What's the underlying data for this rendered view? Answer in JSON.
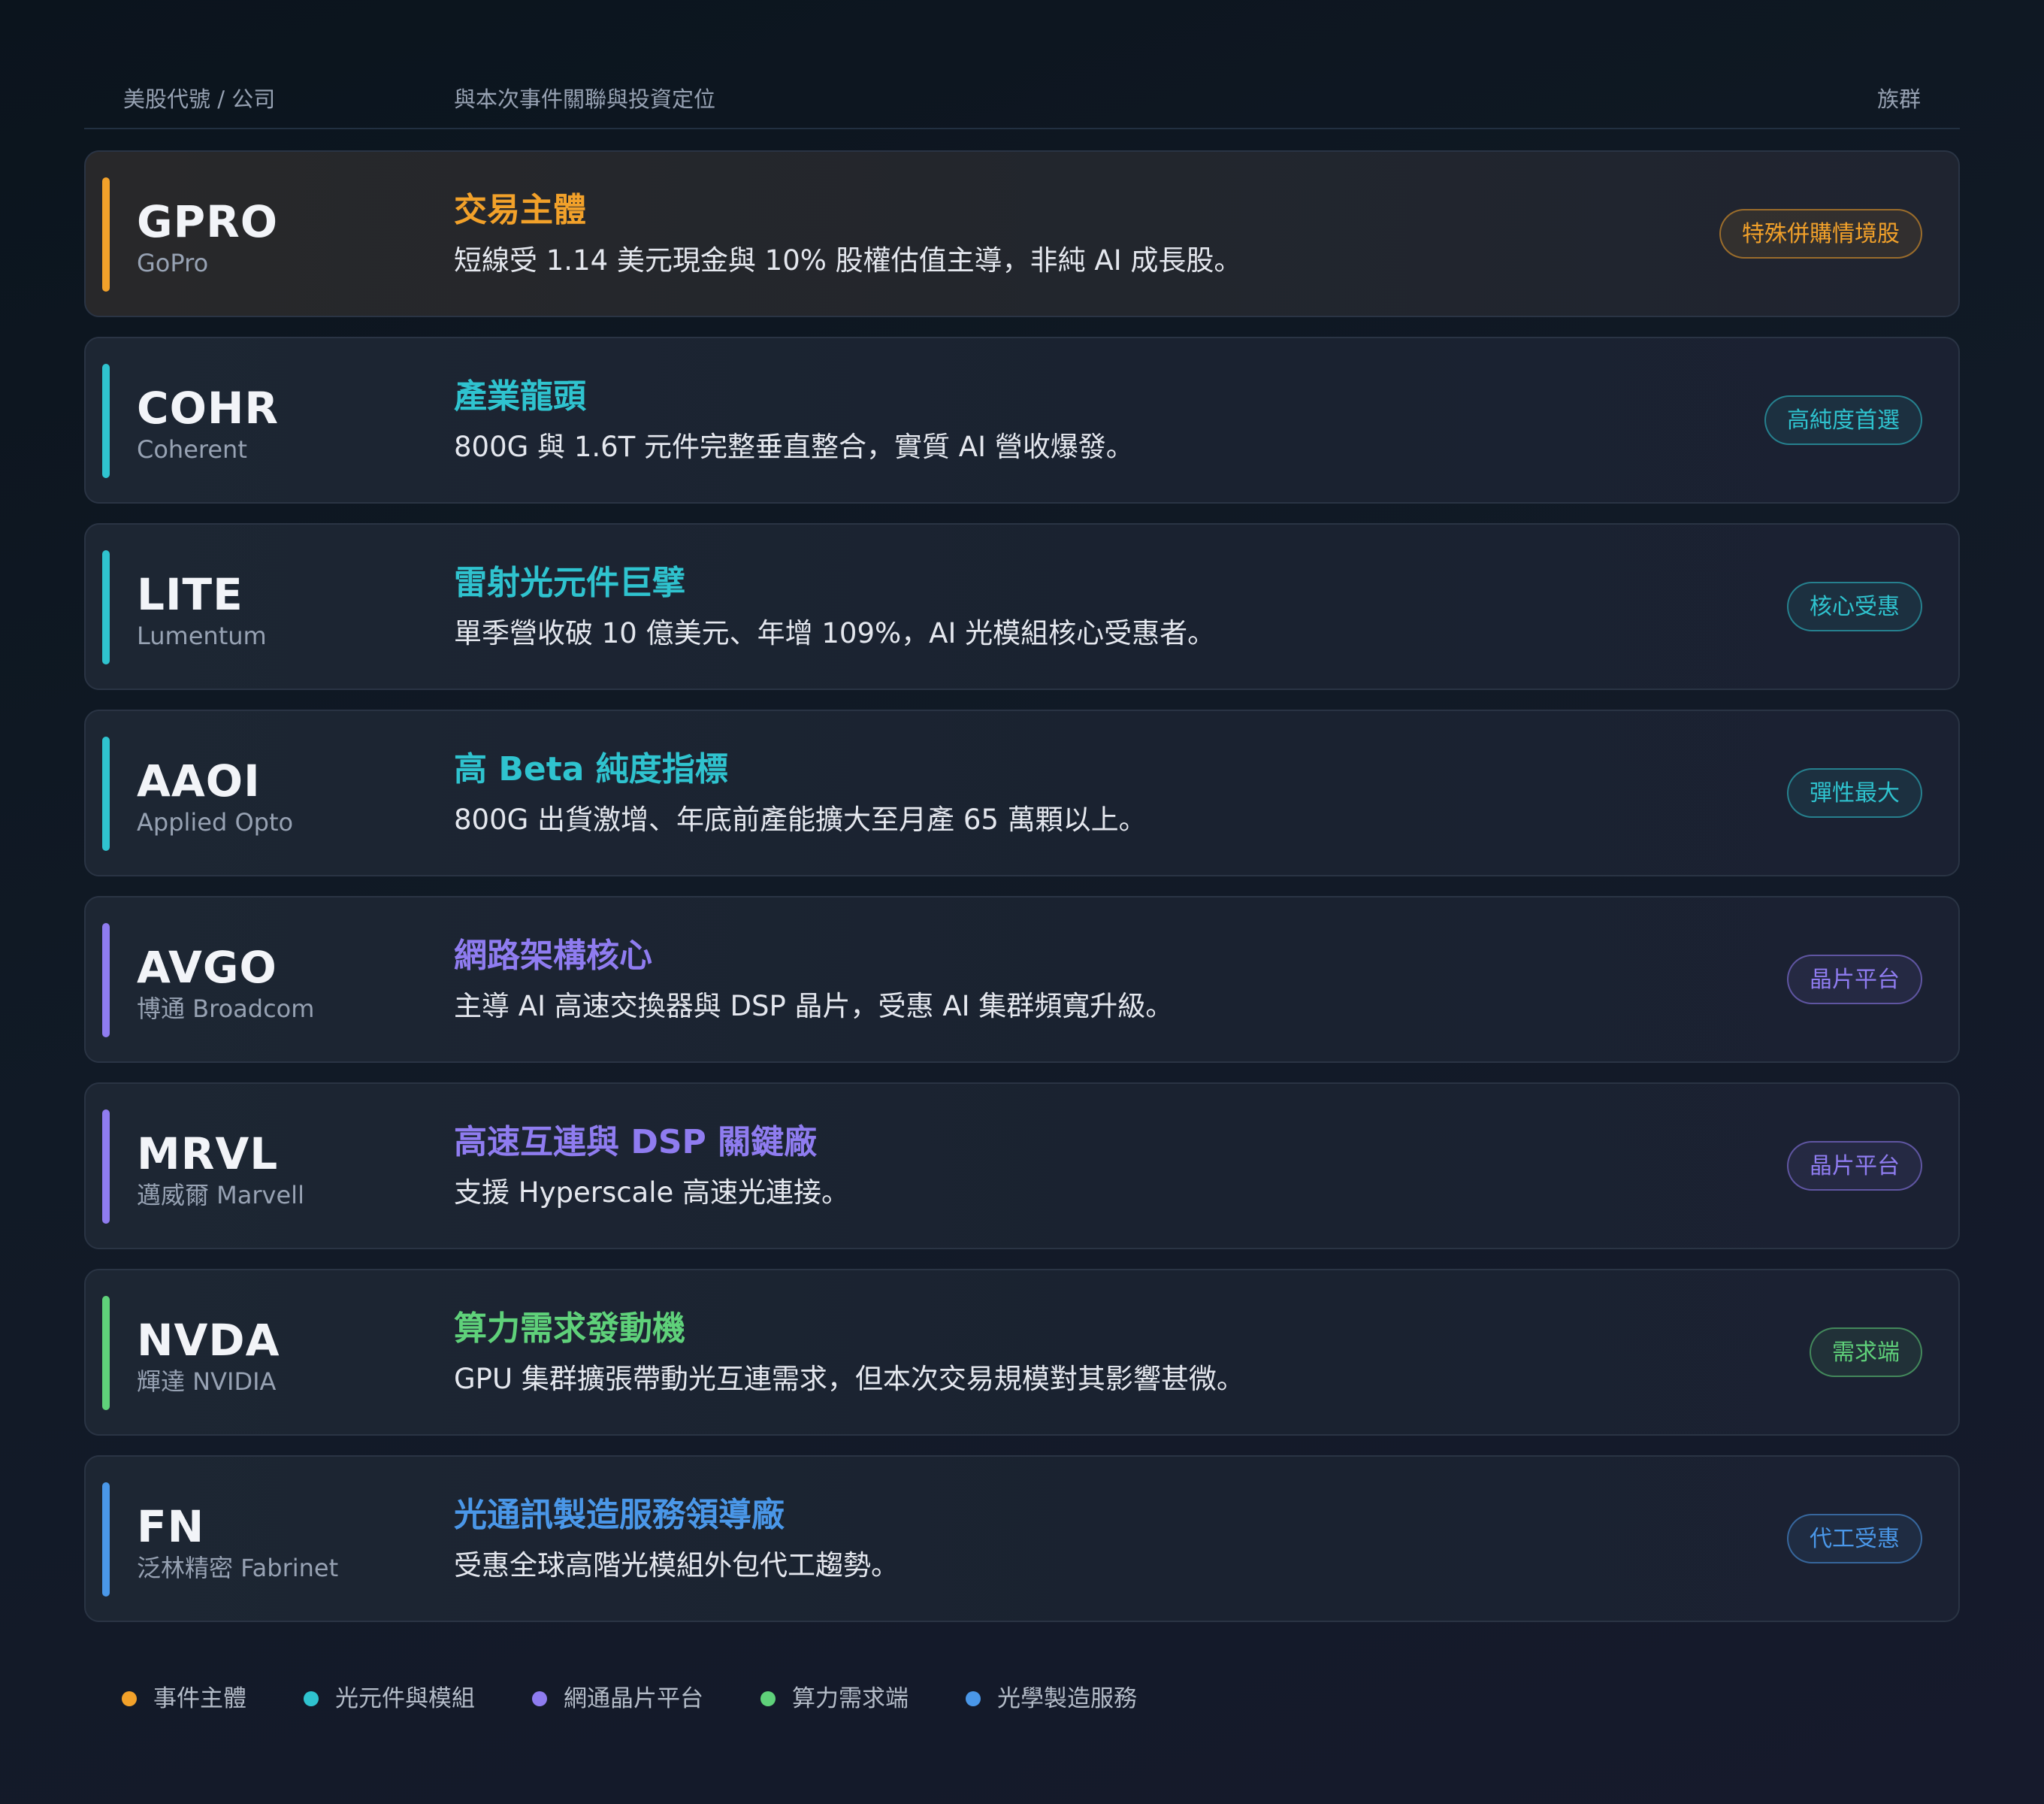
{
  "header": {
    "company_col": "美股代號 / 公司",
    "position_col": "與本次事件關聯與投資定位",
    "group_col": "族群"
  },
  "colors": {
    "orange": "#f2a12a",
    "cyan": "#2fc3cf",
    "purple": "#8f7cf0",
    "green": "#5fd17a",
    "blue": "#4a97e8"
  },
  "rows": [
    {
      "ticker": "GPRO",
      "company": "GoPro",
      "role": "交易主體",
      "desc": "短線受 1.14 美元現金與 10% 股權估值主導，非純 AI 成長股。",
      "badge": "特殊併購情境股",
      "accent": "orange"
    },
    {
      "ticker": "COHR",
      "company": "Coherent",
      "role": "產業龍頭",
      "desc": "800G 與 1.6T 元件完整垂直整合，實質 AI 營收爆發。",
      "badge": "高純度首選",
      "accent": "cyan"
    },
    {
      "ticker": "LITE",
      "company": "Lumentum",
      "role": "雷射光元件巨擘",
      "desc": "單季營收破 10 億美元、年增 109%，AI 光模組核心受惠者。",
      "badge": "核心受惠",
      "accent": "cyan"
    },
    {
      "ticker": "AAOI",
      "company": "Applied Opto",
      "role": "高 Beta 純度指標",
      "desc": "800G 出貨激增、年底前產能擴大至月產 65 萬顆以上。",
      "badge": "彈性最大",
      "accent": "cyan"
    },
    {
      "ticker": "AVGO",
      "company": "博通 Broadcom",
      "role": "網路架構核心",
      "desc": "主導 AI 高速交換器與 DSP 晶片，受惠 AI 集群頻寬升級。",
      "badge": "晶片平台",
      "accent": "purple"
    },
    {
      "ticker": "MRVL",
      "company": "邁威爾 Marvell",
      "role": "高速互連與 DSP 關鍵廠",
      "desc": "支援 Hyperscale 高速光連接。",
      "badge": "晶片平台",
      "accent": "purple"
    },
    {
      "ticker": "NVDA",
      "company": "輝達 NVIDIA",
      "role": "算力需求發動機",
      "desc": "GPU 集群擴張帶動光互連需求，但本次交易規模對其影響甚微。",
      "badge": "需求端",
      "accent": "green"
    },
    {
      "ticker": "FN",
      "company": "泛林精密 Fabrinet",
      "role": "光通訊製造服務領導廠",
      "desc": "受惠全球高階光模組外包代工趨勢。",
      "badge": "代工受惠",
      "accent": "blue"
    }
  ],
  "legend": [
    {
      "label": "事件主體",
      "accent": "orange"
    },
    {
      "label": "光元件與模組",
      "accent": "cyan"
    },
    {
      "label": "網通晶片平台",
      "accent": "purple"
    },
    {
      "label": "算力需求端",
      "accent": "green"
    },
    {
      "label": "光學製造服務",
      "accent": "blue"
    }
  ]
}
